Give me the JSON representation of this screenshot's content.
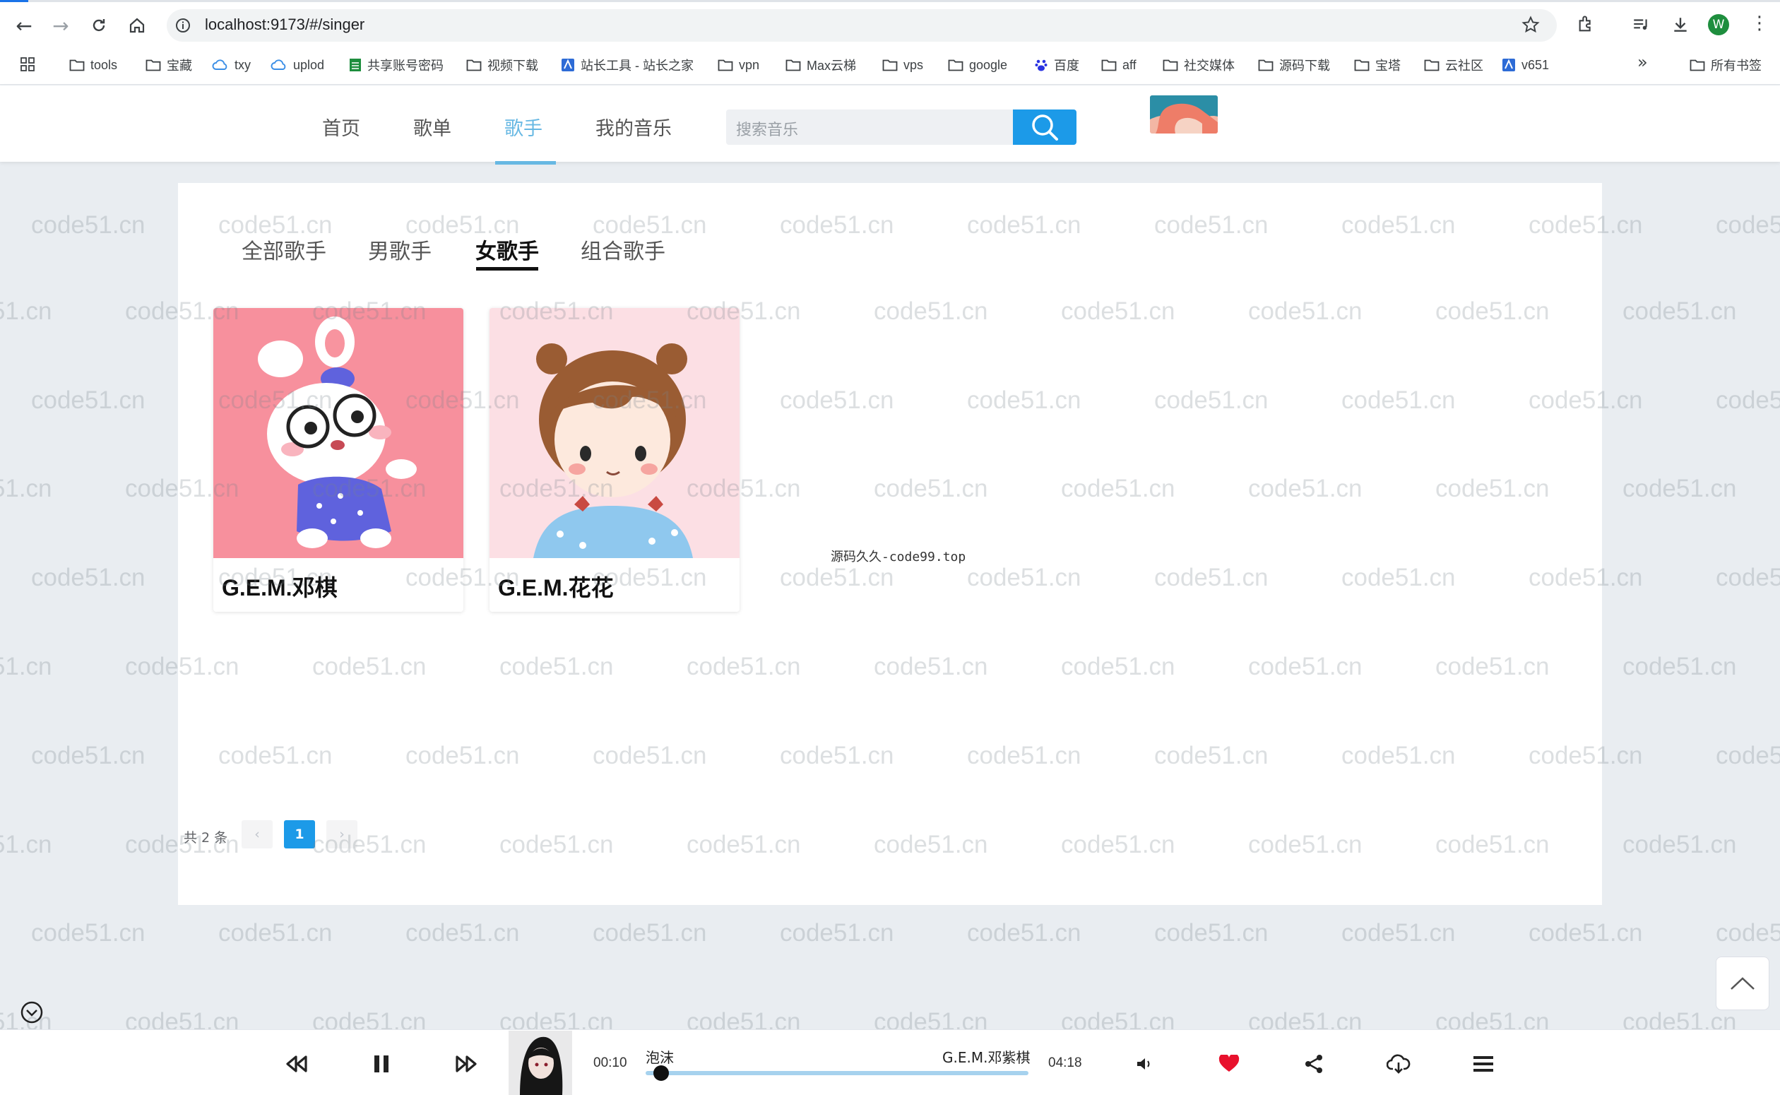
{
  "browser": {
    "url": "localhost:9173/#/singer",
    "profile_initial": "W",
    "bookmarks": [
      {
        "label": "tools",
        "icon": "folder-icon"
      },
      {
        "label": "宝藏",
        "icon": "folder-icon"
      },
      {
        "label": "txy",
        "icon": "cloud-icon"
      },
      {
        "label": "uplod",
        "icon": "cloud-icon"
      },
      {
        "label": "共享账号密码",
        "icon": "sheet-icon"
      },
      {
        "label": "视频下载",
        "icon": "folder-icon"
      },
      {
        "label": "站长工具 - 站长之家",
        "icon": "site-icon"
      },
      {
        "label": "vpn",
        "icon": "folder-icon"
      },
      {
        "label": "Max云梯",
        "icon": "folder-icon"
      },
      {
        "label": "vps",
        "icon": "folder-icon"
      },
      {
        "label": "google",
        "icon": "folder-icon"
      },
      {
        "label": "百度",
        "icon": "baidu-icon"
      },
      {
        "label": "aff",
        "icon": "folder-icon"
      },
      {
        "label": "社交媒体",
        "icon": "folder-icon"
      },
      {
        "label": "源码下载",
        "icon": "folder-icon"
      },
      {
        "label": "宝塔",
        "icon": "folder-icon"
      },
      {
        "label": "云社区",
        "icon": "folder-icon"
      },
      {
        "label": "v651",
        "icon": "site-icon"
      }
    ],
    "all_bookmarks": "所有书签",
    "more": "»"
  },
  "site": {
    "nav": [
      "首页",
      "歌单",
      "歌手",
      "我的音乐"
    ],
    "active_nav": "歌手",
    "search_placeholder": "搜索音乐"
  },
  "tabs": [
    "全部歌手",
    "男歌手",
    "女歌手",
    "组合歌手"
  ],
  "active_tab": "女歌手",
  "singers": [
    {
      "name": "G.E.M.邓棋"
    },
    {
      "name": "G.E.M.花花"
    }
  ],
  "floating_note": "源码久久-code99.top",
  "pagination": {
    "total_text": "共 2 条",
    "prev": "‹",
    "current": "1",
    "next": "›"
  },
  "watermark": "code51.cn",
  "player": {
    "song": "泡沫",
    "artist": "G.E.M.邓紫棋",
    "current_time": "00:10",
    "duration": "04:18",
    "progress": 0.04
  },
  "colors": {
    "accent": "#1c9ae8",
    "nav_active": "#67b8e3",
    "like": "#e8112d"
  }
}
